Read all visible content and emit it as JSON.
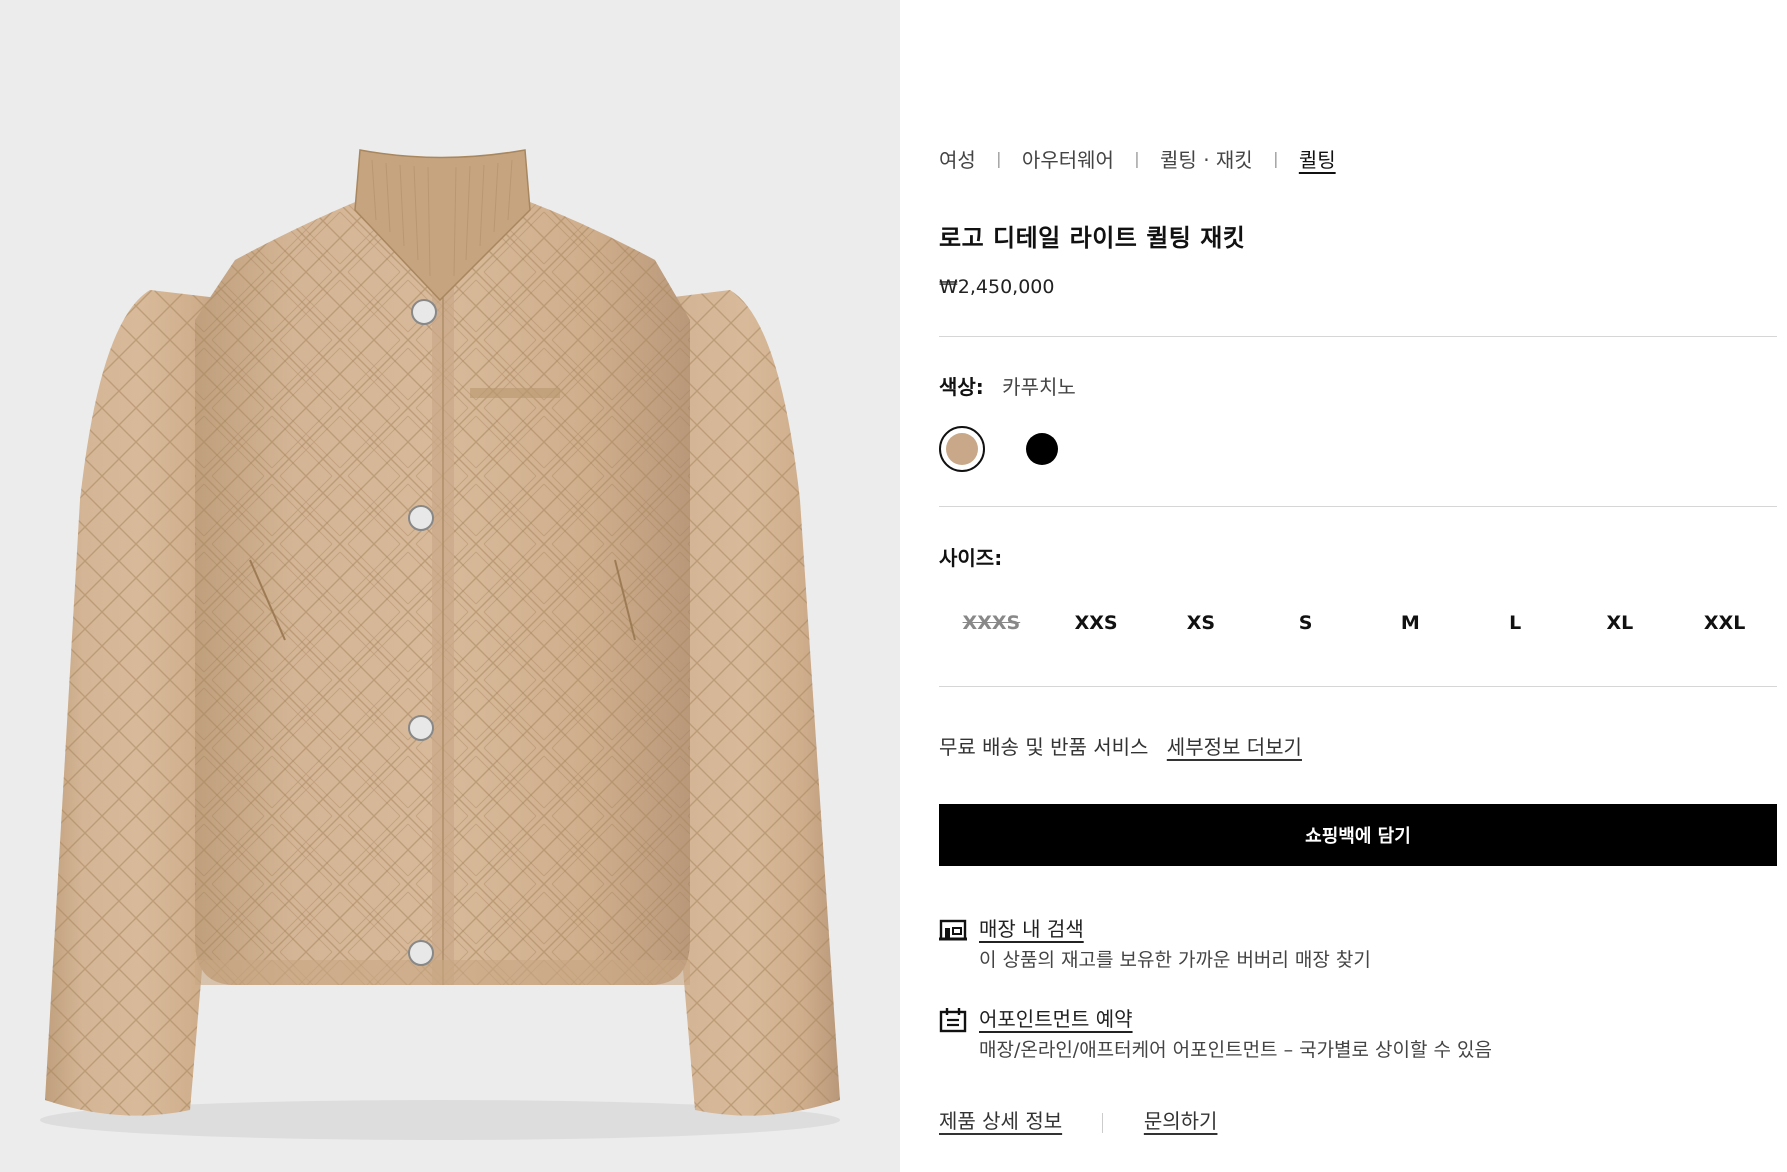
{
  "product_image": {
    "alt": "로고 디테일 라이트 퀼팅 재킷",
    "colors": {
      "background": "#ececec",
      "fabric": "#d2b394",
      "fabric_shade": "#b8976f",
      "quilt_line": "#a8875f"
    }
  },
  "breadcrumb": {
    "items": [
      "여성",
      "아우터웨어",
      "퀼팅 · 재킷",
      "퀼팅"
    ],
    "separator": "|"
  },
  "product": {
    "title": "로고 디테일 라이트 퀼팅 재킷",
    "price": "₩2,450,000"
  },
  "color": {
    "label": "색상:",
    "selected": "카푸치노",
    "swatches": [
      {
        "name": "카푸치노",
        "hex": "#c8a888",
        "selected": true
      },
      {
        "name": "블랙",
        "hex": "#000000",
        "selected": false
      }
    ]
  },
  "size": {
    "label": "사이즈:",
    "options": [
      {
        "label": "XXXS",
        "available": false
      },
      {
        "label": "XXS",
        "available": true
      },
      {
        "label": "XS",
        "available": true
      },
      {
        "label": "S",
        "available": true
      },
      {
        "label": "M",
        "available": true
      },
      {
        "label": "L",
        "available": true
      },
      {
        "label": "XL",
        "available": true
      },
      {
        "label": "XXL",
        "available": true
      }
    ]
  },
  "shipping": {
    "text": "무료 배송 및 반품 서비스",
    "link": "세부정보 더보기"
  },
  "cta": {
    "add_to_bag": "쇼핑백에 담기"
  },
  "services": [
    {
      "icon": "store-icon",
      "title": "매장 내 검색",
      "description": "이 상품의 재고를 보유한 가까운 버버리 매장 찾기"
    },
    {
      "icon": "calendar-icon",
      "title": "어포인트먼트 예약",
      "description": "매장/온라인/애프터케어 어포인트먼트 – 국가별로 상이할 수 있음"
    }
  ],
  "footer_links": {
    "details": "제품 상세 정보",
    "inquiry": "문의하기"
  },
  "theme": {
    "button_bg": "#000000",
    "button_text": "#ffffff",
    "divider": "#d6d6d6"
  }
}
